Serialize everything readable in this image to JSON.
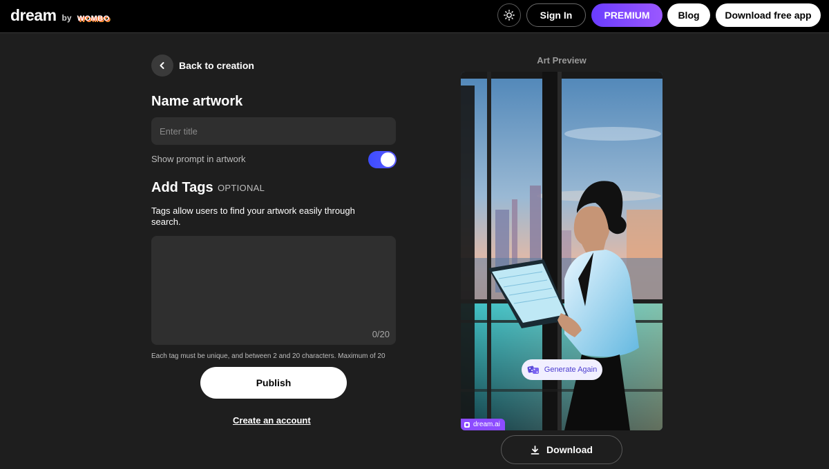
{
  "header": {
    "logo_text": "dream",
    "logo_by": "by",
    "logo_brand": "WOMBO",
    "theme_icon": "sun-icon",
    "signin_label": "Sign In",
    "premium_label": "PREMIUM",
    "blog_label": "Blog",
    "download_app_label": "Download free app"
  },
  "form": {
    "back_label": "Back to creation",
    "name_title": "Name artwork",
    "title_placeholder": "Enter title",
    "title_value": "",
    "show_prompt_label": "Show prompt in artwork",
    "show_prompt_enabled": true,
    "tags_title": "Add Tags",
    "tags_optional": "OPTIONAL",
    "tags_description": "Tags allow users to find your artwork easily through search.",
    "tags_count": "0/20",
    "tags_note": "Each tag must be unique, and between 2 and 20 characters. Maximum of 20",
    "publish_label": "Publish",
    "create_account_label": "Create an account"
  },
  "preview": {
    "label": "Art Preview",
    "generate_again_label": "Generate Again",
    "watermark_label": "dream.ai",
    "download_label": "Download"
  },
  "colors": {
    "background": "#1e1e1e",
    "header": "#000000",
    "accent_premium": "#7b4cff",
    "toggle": "#4a4cff"
  }
}
